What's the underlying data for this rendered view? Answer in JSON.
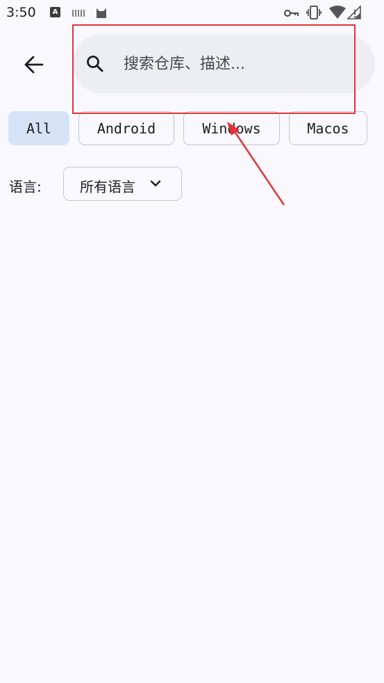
{
  "status_bar": {
    "time": "3:50",
    "left_icons": [
      "text-a-icon",
      "keyboard-icon",
      "cat-icon"
    ],
    "right_icons": [
      "vpn-key-icon",
      "vibrate-icon",
      "wifi-icon",
      "battery-icon"
    ]
  },
  "header": {
    "back_icon": "arrow-left-icon",
    "search": {
      "icon": "search-icon",
      "placeholder": "搜索仓库、描述...",
      "value": ""
    }
  },
  "filters": {
    "chips": [
      {
        "label": "All",
        "selected": true
      },
      {
        "label": "Android",
        "selected": false
      },
      {
        "label": "Windows",
        "selected": false
      },
      {
        "label": "Macos",
        "selected": false
      }
    ]
  },
  "language": {
    "label": "语言:",
    "selected": "所有语言",
    "dropdown_icon": "chevron-down-icon"
  },
  "colors": {
    "background": "#f8f8fe",
    "search_bg": "#eceef2",
    "chip_selected": "#d6e3f7",
    "chip_border": "#c4c6cf",
    "annotation_red": "#e53238"
  }
}
